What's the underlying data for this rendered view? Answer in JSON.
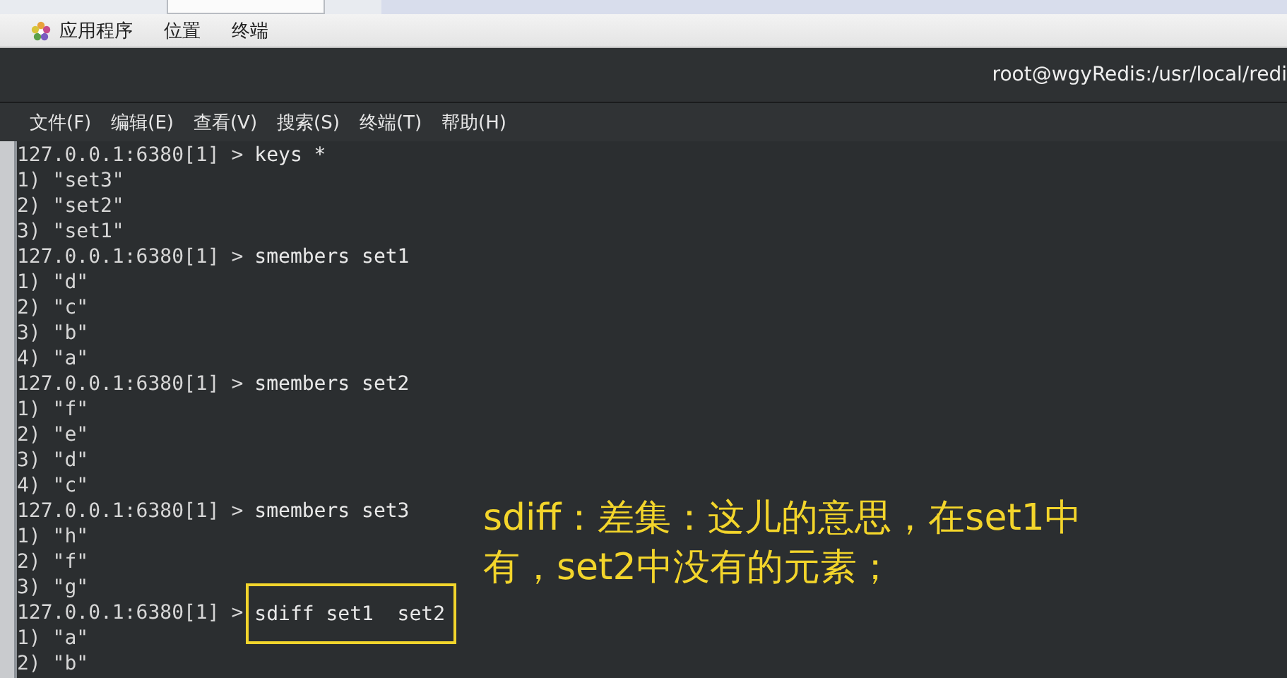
{
  "top_panel": {
    "menus": [
      {
        "label": "应用程序",
        "kind": "apps"
      },
      {
        "label": "位置",
        "kind": "plain"
      },
      {
        "label": "终端",
        "kind": "plain"
      }
    ]
  },
  "window": {
    "title": "root@wgyRedis:/usr/local/redi"
  },
  "menu_bar": [
    "文件(F)",
    "编辑(E)",
    "查看(V)",
    "搜索(S)",
    "终端(T)",
    "帮助(H)"
  ],
  "terminal": {
    "lines": [
      {
        "kind": "prompt",
        "prompt": "127.0.0.1:6380[1] >",
        "command": "keys *",
        "highlighted": false
      },
      {
        "kind": "output",
        "text": "1) \"set3\""
      },
      {
        "kind": "output",
        "text": "2) \"set2\""
      },
      {
        "kind": "output",
        "text": "3) \"set1\""
      },
      {
        "kind": "prompt",
        "prompt": "127.0.0.1:6380[1] >",
        "command": "smembers set1",
        "highlighted": false
      },
      {
        "kind": "output",
        "text": "1) \"d\""
      },
      {
        "kind": "output",
        "text": "2) \"c\""
      },
      {
        "kind": "output",
        "text": "3) \"b\""
      },
      {
        "kind": "output",
        "text": "4) \"a\""
      },
      {
        "kind": "prompt",
        "prompt": "127.0.0.1:6380[1] >",
        "command": "smembers set2",
        "highlighted": false
      },
      {
        "kind": "output",
        "text": "1) \"f\""
      },
      {
        "kind": "output",
        "text": "2) \"e\""
      },
      {
        "kind": "output",
        "text": "3) \"d\""
      },
      {
        "kind": "output",
        "text": "4) \"c\""
      },
      {
        "kind": "prompt",
        "prompt": "127.0.0.1:6380[1] >",
        "command": "smembers set3",
        "highlighted": false
      },
      {
        "kind": "output",
        "text": "1) \"h\""
      },
      {
        "kind": "output",
        "text": "2) \"f\""
      },
      {
        "kind": "output",
        "text": "3) \"g\""
      },
      {
        "kind": "prompt",
        "prompt": "127.0.0.1:6380[1] >",
        "command": "sdiff set1  set2",
        "highlighted": true
      },
      {
        "kind": "output",
        "text": "1) \"a\""
      },
      {
        "kind": "output",
        "text": "2) \"b\""
      }
    ]
  },
  "annotation": {
    "lines": [
      "sdiff：差集：这儿的意思，在set1中",
      "有，set2中没有的元素；"
    ]
  }
}
